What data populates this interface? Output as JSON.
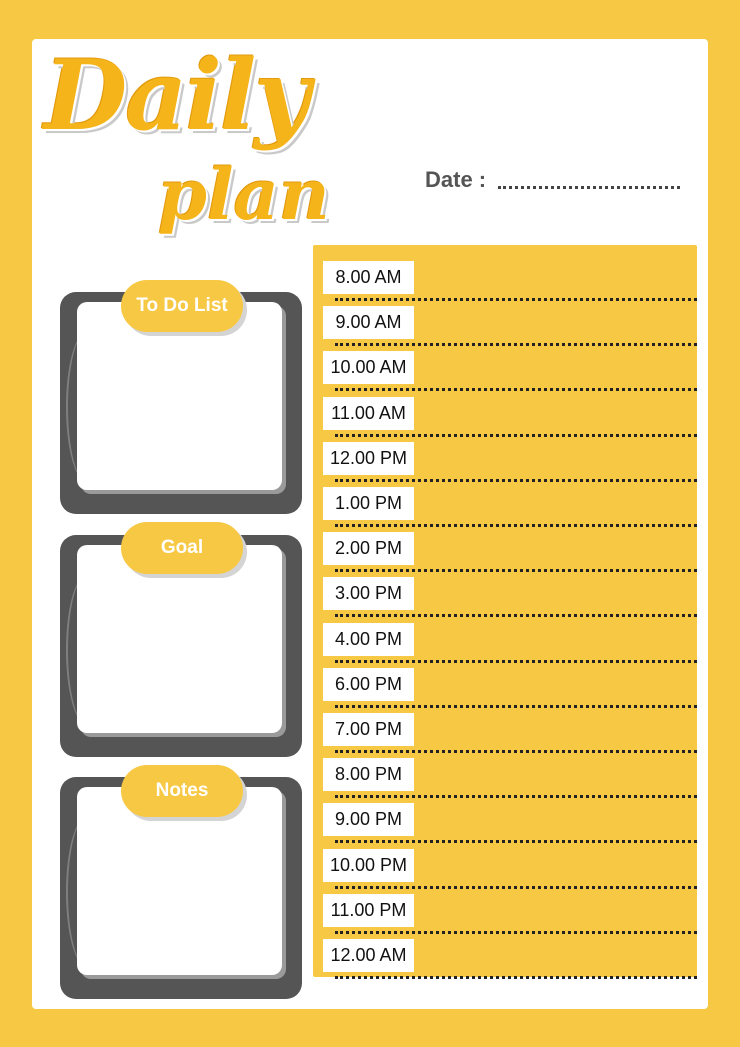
{
  "title": {
    "line1": "Daily",
    "line2": "plan"
  },
  "date": {
    "label": "Date :"
  },
  "sections": [
    {
      "label": "To Do List"
    },
    {
      "label": "Goal"
    },
    {
      "label": "Notes"
    }
  ],
  "schedule": {
    "times": [
      "8.00 AM",
      "9.00 AM",
      "10.00 AM",
      "11.00 AM",
      "12.00 PM",
      "1.00 PM",
      "2.00 PM",
      "3.00 PM",
      "4.00 PM",
      "6.00 PM",
      "7.00 PM",
      "8.00 PM",
      "9.00 PM",
      "10.00 PM",
      "11.00 PM",
      "12.00 AM"
    ]
  },
  "colors": {
    "accent": "#f7c843",
    "title": "#f4b41a",
    "frame": "#555555",
    "page": "#ffffff"
  }
}
